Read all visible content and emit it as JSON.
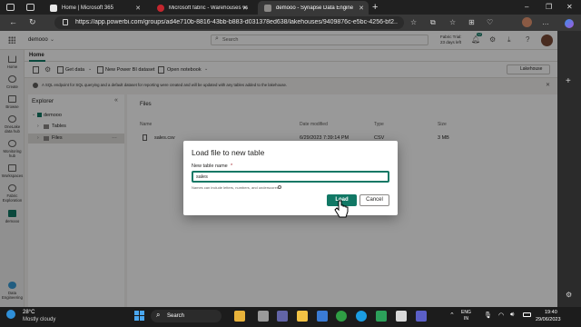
{
  "browser": {
    "tabs": [
      {
        "title": "Home | Microsoft 365",
        "active": false,
        "favicon_color": "#e8e8e8"
      },
      {
        "title": "Microsoft fabric - Warehouses vs",
        "active": false,
        "favicon_color": "#c4262e"
      },
      {
        "title": "demooo - Synapse Data Engine",
        "active": true,
        "favicon_color": "#8a8886"
      }
    ],
    "url": "https://app.powerbi.com/groups/ad4e710b-8816-43bb-b883-d031378ed638/lakehouses/9409876c-e5bc-4256-bf2..."
  },
  "fabric": {
    "workspace": "demooo",
    "search_placeholder": "Search",
    "trial_line1": "Fabric Trial:",
    "trial_line2": "23 days left",
    "notification_count": "12",
    "rail": {
      "home": "Home",
      "create": "Create",
      "browse": "Browse",
      "onelake_line1": "OneLake",
      "onelake_line2": "data hub",
      "monitoring_line1": "Monitoring",
      "monitoring_line2": "hub",
      "workspaces": "Workspaces",
      "fabric_line1": "Fabric",
      "fabric_line2": "Exploration",
      "demooo": "demooo",
      "bottom_line1": "Data",
      "bottom_line2": "Engineering"
    },
    "ribbon": {
      "tab_home": "Home",
      "get_data": "Get data",
      "new_dataset": "New Power BI dataset",
      "open_notebook": "Open notebook",
      "lakehouse_switch": "Lakehouse"
    },
    "info_message": "A SQL endpoint for SQL querying and a default dataset for reporting were created and will be updated with any tables added to the lakehouse.",
    "explorer": {
      "title": "Explorer",
      "root": "demooo",
      "tables": "Tables",
      "files": "Files"
    },
    "files_pane": {
      "title": "Files",
      "columns": [
        "Name",
        "Date modified",
        "Type",
        "Size"
      ],
      "rows": [
        {
          "name": "sales.csv",
          "date": "6/29/2023 7:39:14 PM",
          "type": "CSV",
          "size": "3 MB"
        }
      ]
    }
  },
  "dialog": {
    "title": "Load file to new table",
    "field_label": "New table name",
    "required_mark": "*",
    "field_value": "sales",
    "hint": "Names can include letters, numbers, and underscores",
    "load_button": "Load",
    "cancel_button": "Cancel"
  },
  "taskbar": {
    "weather_temp": "28°C",
    "weather_desc": "Mostly cloudy",
    "search_label": "Search",
    "language_line1": "ENG",
    "language_line2": "IN",
    "time": "19:40",
    "date": "29/06/2023"
  },
  "colors": {
    "accent": "#117865",
    "overlay": "rgba(0,0,0,0.4)",
    "browser_chrome": "#383838",
    "taskbar": "#1c1c1c"
  }
}
